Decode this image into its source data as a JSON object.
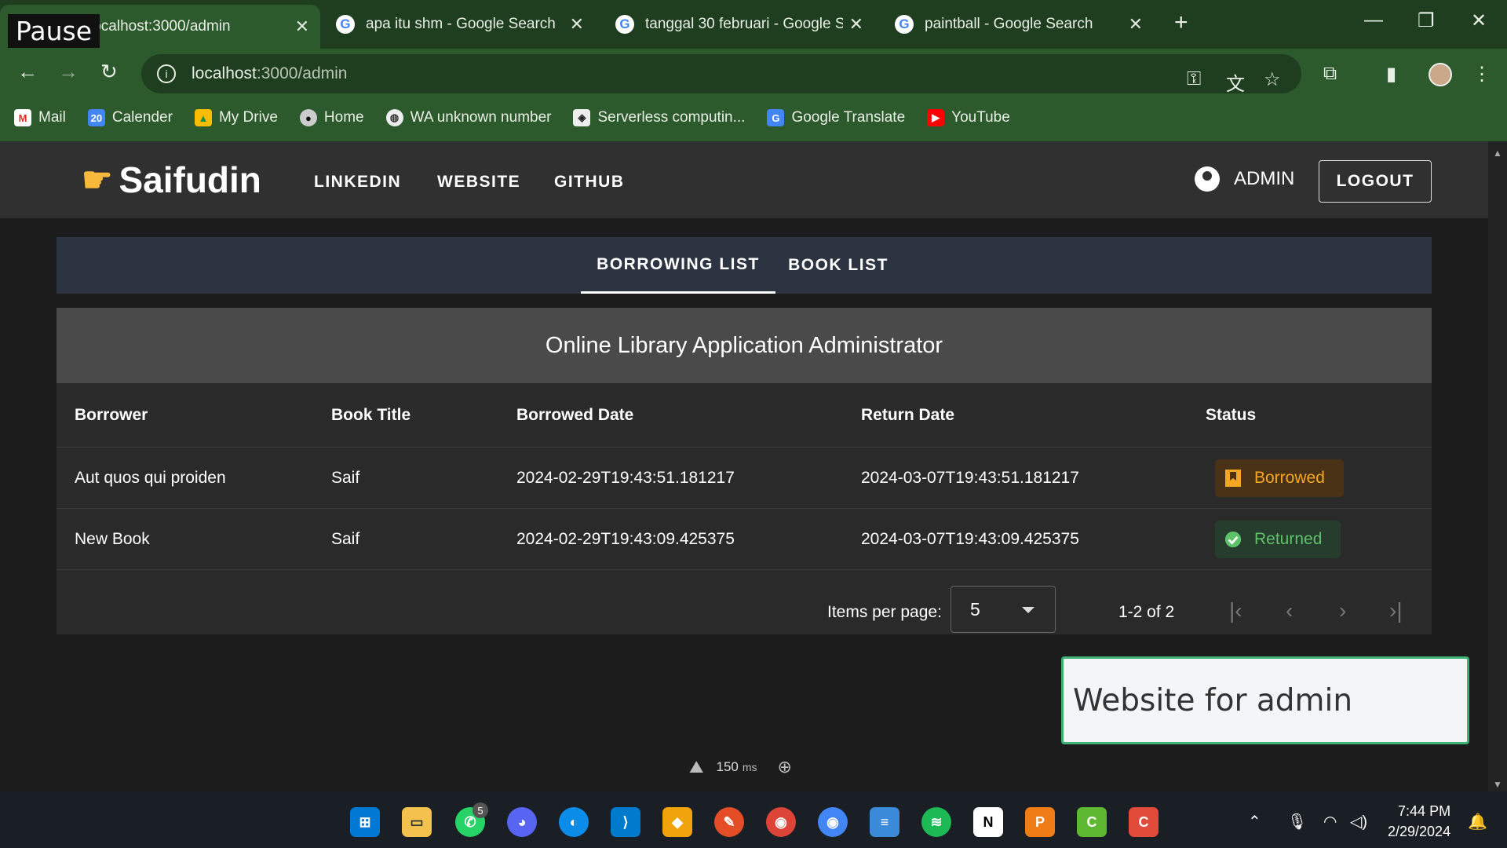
{
  "browser": {
    "pause_label": "Pause",
    "tabs": [
      {
        "title": "localhost:3000/admin",
        "favicon": "app-icon"
      },
      {
        "title": "apa itu shm - Google Search",
        "favicon": "google-icon"
      },
      {
        "title": "tanggal 30 februari - Google Se",
        "favicon": "google-icon"
      },
      {
        "title": "paintball - Google Search",
        "favicon": "google-icon"
      }
    ],
    "url_host": "localhost",
    "url_path": ":3000/admin",
    "bookmarks": [
      {
        "label": "Mail",
        "icon": "gmail-icon"
      },
      {
        "label": "Calender",
        "icon": "calendar-icon"
      },
      {
        "label": "My Drive",
        "icon": "drive-icon"
      },
      {
        "label": "Home",
        "icon": "home-icon"
      },
      {
        "label": "WA unknown number",
        "icon": "globe-icon"
      },
      {
        "label": "Serverless computin...",
        "icon": "cube-icon"
      },
      {
        "label": "Google Translate",
        "icon": "translate-icon"
      },
      {
        "label": "YouTube",
        "icon": "youtube-icon"
      }
    ]
  },
  "app": {
    "brand": "Saifudin",
    "nav_links": [
      "LINKEDIN",
      "WEBSITE",
      "GITHUB"
    ],
    "admin_label": "ADMIN",
    "logout_label": "LOGOUT",
    "tabs": [
      "BORROWING LIST",
      "BOOK LIST"
    ],
    "active_tab": "BORROWING LIST",
    "card_title": "Online Library Application Administrator",
    "table": {
      "headers": [
        "Borrower",
        "Book Title",
        "Borrowed Date",
        "Return Date",
        "Status"
      ],
      "rows": [
        {
          "borrower": "Aut quos qui proiden",
          "title": "Saif",
          "borrowed": "2024-02-29T19:43:51.181217",
          "return": "2024-03-07T19:43:51.181217",
          "status": "Borrowed"
        },
        {
          "borrower": "New Book",
          "title": "Saif",
          "borrowed": "2024-02-29T19:43:09.425375",
          "return": "2024-03-07T19:43:09.425375",
          "status": "Returned"
        }
      ]
    },
    "pagination": {
      "items_per_page_label": "Items per page:",
      "items_per_page": "5",
      "range": "1-2 of 2"
    },
    "popup_text": "Website for admin",
    "dev_timing": "150",
    "dev_timing_unit": "ms"
  },
  "taskbar": {
    "whatsapp_badge": "5",
    "time": "7:44 PM",
    "date": "2/29/2024"
  },
  "colors": {
    "chrome": "#2d5a2d",
    "borrowed": "#f5a623",
    "returned": "#5ec26a"
  }
}
